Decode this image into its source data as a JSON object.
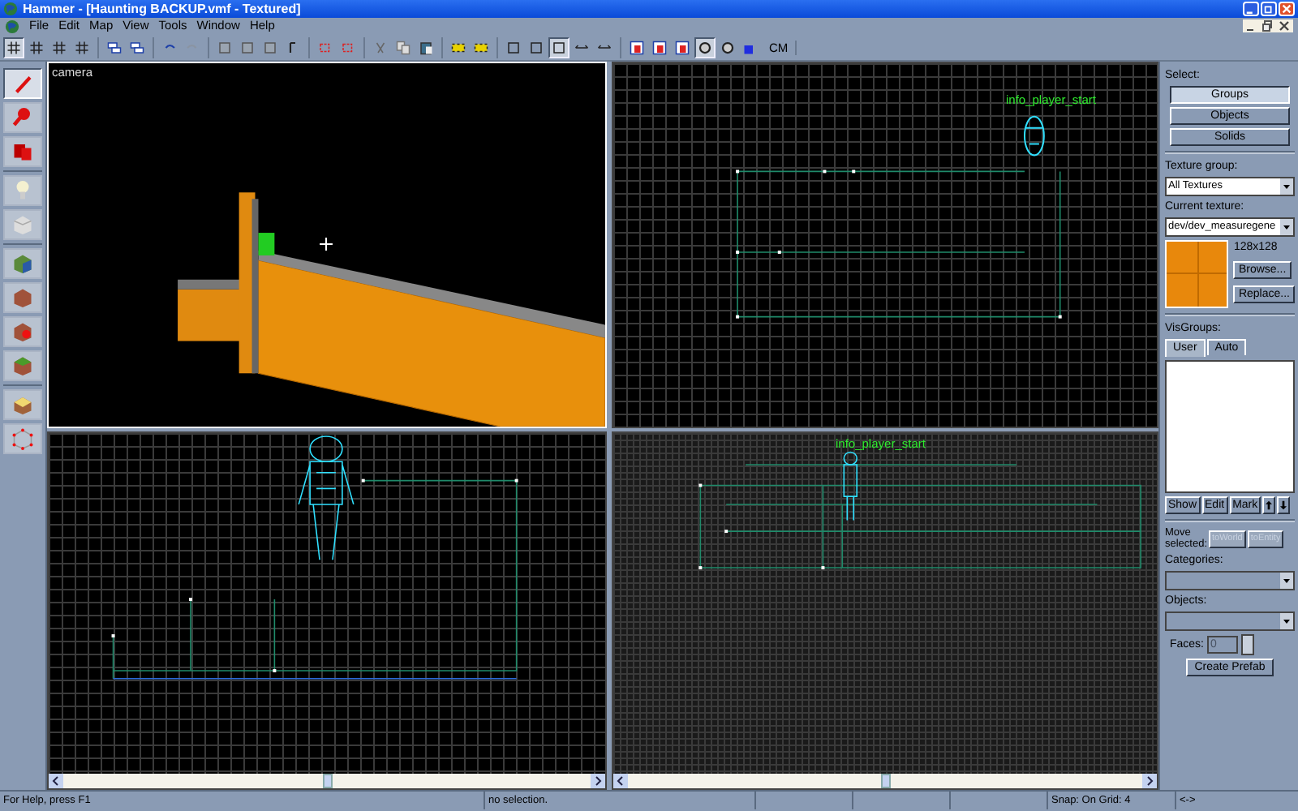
{
  "window": {
    "title": "Hammer - [Haunting BACKUP.vmf - Textured]"
  },
  "menu": [
    "File",
    "Edit",
    "Map",
    "View",
    "Tools",
    "Window",
    "Help"
  ],
  "toolbar": {
    "label": "CM"
  },
  "tools": [
    {
      "selected": true
    },
    {
      "selected": false
    },
    {
      "selected": false
    },
    {
      "selected": false
    },
    {
      "selected": false
    },
    {
      "selected": false
    },
    {
      "selected": false
    },
    {
      "selected": false
    },
    {
      "selected": false
    },
    {
      "selected": false
    },
    {
      "selected": false
    }
  ],
  "viewports": {
    "camera": {
      "label": "camera"
    },
    "top": {
      "entity_label": "info_player_start"
    },
    "side": {
      "entity_label": "info_player_start"
    }
  },
  "panel": {
    "select_label": "Select:",
    "select_buttons": [
      {
        "label": "Groups",
        "selected": true
      },
      {
        "label": "Objects",
        "selected": false
      },
      {
        "label": "Solids",
        "selected": false
      }
    ],
    "texture_group_label": "Texture group:",
    "texture_group": "All Textures",
    "current_texture_label": "Current texture:",
    "current_texture": "dev/dev_measuregene",
    "texture_size": "128x128",
    "browse": "Browse...",
    "replace": "Replace...",
    "visgroups_label": "VisGroups:",
    "visgroup_tabs": [
      {
        "label": "User",
        "selected": true
      },
      {
        "label": "Auto",
        "selected": false
      }
    ],
    "visgroup_buttons": [
      "Show",
      "Edit",
      "Mark"
    ],
    "move_label": "Move selected:",
    "move_buttons": [
      {
        "label": "toWorld",
        "disabled": true
      },
      {
        "label": "toEntity",
        "disabled": true
      }
    ],
    "categories_label": "Categories:",
    "objects_label": "Objects:",
    "faces_label": "Faces:",
    "faces_value": "0",
    "create_prefab": "Create Prefab"
  },
  "status_bar": {
    "help": "For Help, press F1",
    "selection": "no selection.",
    "snap": "Snap: On Grid: 4",
    "arrows": "<->"
  }
}
